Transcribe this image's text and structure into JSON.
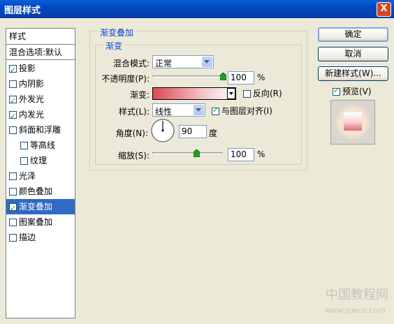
{
  "window": {
    "title": "图层样式",
    "close": "X"
  },
  "sidebar": {
    "header": "样式",
    "blend_options": "混合选项:默认",
    "items": [
      {
        "label": "投影",
        "checked": true
      },
      {
        "label": "内阴影",
        "checked": false
      },
      {
        "label": "外发光",
        "checked": true
      },
      {
        "label": "内发光",
        "checked": true
      },
      {
        "label": "斜面和浮雕",
        "checked": false
      },
      {
        "label": "等高线",
        "checked": false
      },
      {
        "label": "纹理",
        "checked": false
      },
      {
        "label": "光泽",
        "checked": false
      },
      {
        "label": "颜色叠加",
        "checked": false
      },
      {
        "label": "渐变叠加",
        "checked": true
      },
      {
        "label": "图案叠加",
        "checked": false
      },
      {
        "label": "描边",
        "checked": false
      }
    ]
  },
  "panel": {
    "group_title": "渐变叠加",
    "subgroup_title": "渐变",
    "blend_mode_label": "混合模式:",
    "blend_mode_value": "正常",
    "opacity_label": "不透明度(P):",
    "opacity_value": "100",
    "opacity_unit": "%",
    "gradient_label": "渐变:",
    "reverse_label": "反向(R)",
    "style_label": "样式(L):",
    "style_value": "线性",
    "align_label": "与图层对齐(I)",
    "angle_label": "角度(N):",
    "angle_value": "90",
    "angle_unit": "度",
    "scale_label": "缩放(S):",
    "scale_value": "100",
    "scale_unit": "%",
    "gradient_colors": [
      "#dd4a55",
      "#f3c3c7",
      "#ffffff"
    ]
  },
  "buttons": {
    "ok": "确定",
    "cancel": "取消",
    "new_style": "新建样式(W)...",
    "preview": "预览(V)"
  },
  "watermark": {
    "line1": "中国教程网",
    "line2": "www.jcwcn.com"
  }
}
